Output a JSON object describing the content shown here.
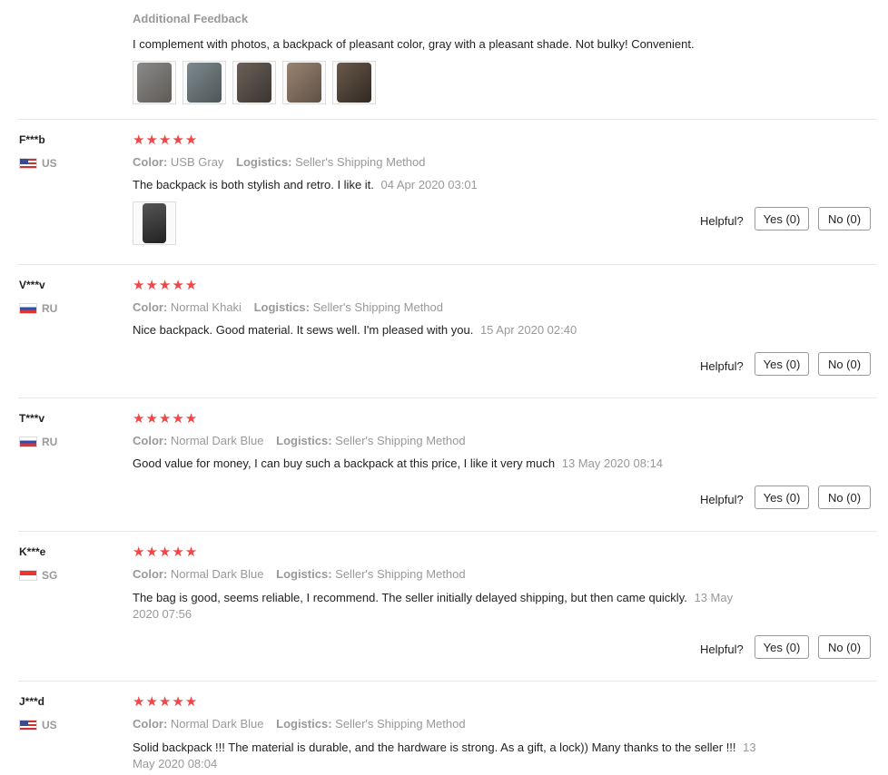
{
  "top": {
    "heading": "Additional Feedback",
    "text": "I complement with photos, a backpack of pleasant color, gray with a pleasant shade. Not bulky! Convenient."
  },
  "labels": {
    "color": "Color:",
    "logistics": "Logistics:",
    "helpful": "Helpful?",
    "stars": "★★★★★"
  },
  "reviews": [
    {
      "user": "F***b",
      "country": "US",
      "color": "USB Gray",
      "logistics": "Seller's Shipping Method",
      "text": "The backpack is both stylish and retro. I like it.",
      "date": "04 Apr 2020 03:01",
      "yes": "Yes (0)",
      "no": "No (0)"
    },
    {
      "user": "V***v",
      "country": "RU",
      "color": "Normal Khaki",
      "logistics": "Seller's Shipping Method",
      "text": "Nice backpack. Good material. It sews well. I'm pleased with you.",
      "date": "15 Apr 2020 02:40",
      "yes": "Yes (0)",
      "no": "No (0)"
    },
    {
      "user": "T***v",
      "country": "RU",
      "color": "Normal Dark Blue",
      "logistics": "Seller's Shipping Method",
      "text": "Good value for money, I can buy such a backpack at this price, I like it very much",
      "date": "13 May 2020 08:14",
      "yes": "Yes (0)",
      "no": "No (0)"
    },
    {
      "user": "K***e",
      "country": "SG",
      "color": "Normal Dark Blue",
      "logistics": "Seller's Shipping Method",
      "text": "The bag is good, seems reliable, I recommend. The seller initially delayed shipping, but then came quickly.",
      "date_line1": "13 May",
      "date_line2": "2020 07:56",
      "yes": "Yes (0)",
      "no": "No (0)"
    },
    {
      "user": "J***d",
      "country": "US",
      "color": "Normal Dark Blue",
      "logistics": "Seller's Shipping Method",
      "text": "Solid backpack !!! The material is durable, and the hardware is strong. As a gift, a lock)) Many thanks to the seller !!!",
      "date_line1": "13",
      "date_line2": "May 2020 08:04"
    }
  ]
}
